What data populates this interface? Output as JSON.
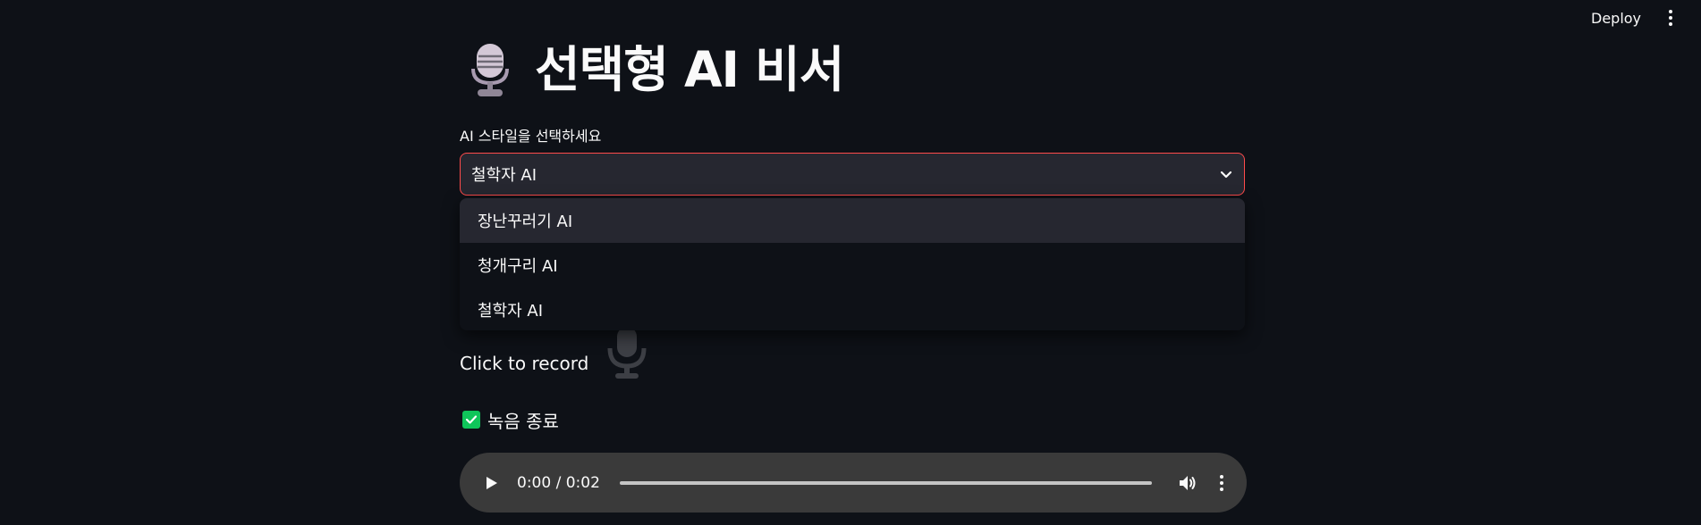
{
  "header": {
    "deploy_label": "Deploy"
  },
  "title": {
    "text": "선택형 AI 비서",
    "icon": "microphone-icon"
  },
  "select": {
    "label": "AI 스타일을 선택하세요",
    "value": "철학자 AI",
    "options": [
      "장난꾸러기 AI",
      "청개구리 AI",
      "철학자 AI"
    ],
    "highlighted_index": 0,
    "accent_color": "#ff4b4b"
  },
  "recorder": {
    "label": "Click to record",
    "icon": "microphone-icon"
  },
  "checkbox": {
    "label": "녹음 종료",
    "checked": true,
    "color": "#0fc55a"
  },
  "audio": {
    "time": "0:00 / 0:02",
    "progress": 0
  },
  "colors": {
    "background": "#0e1117",
    "surface": "#262730"
  }
}
